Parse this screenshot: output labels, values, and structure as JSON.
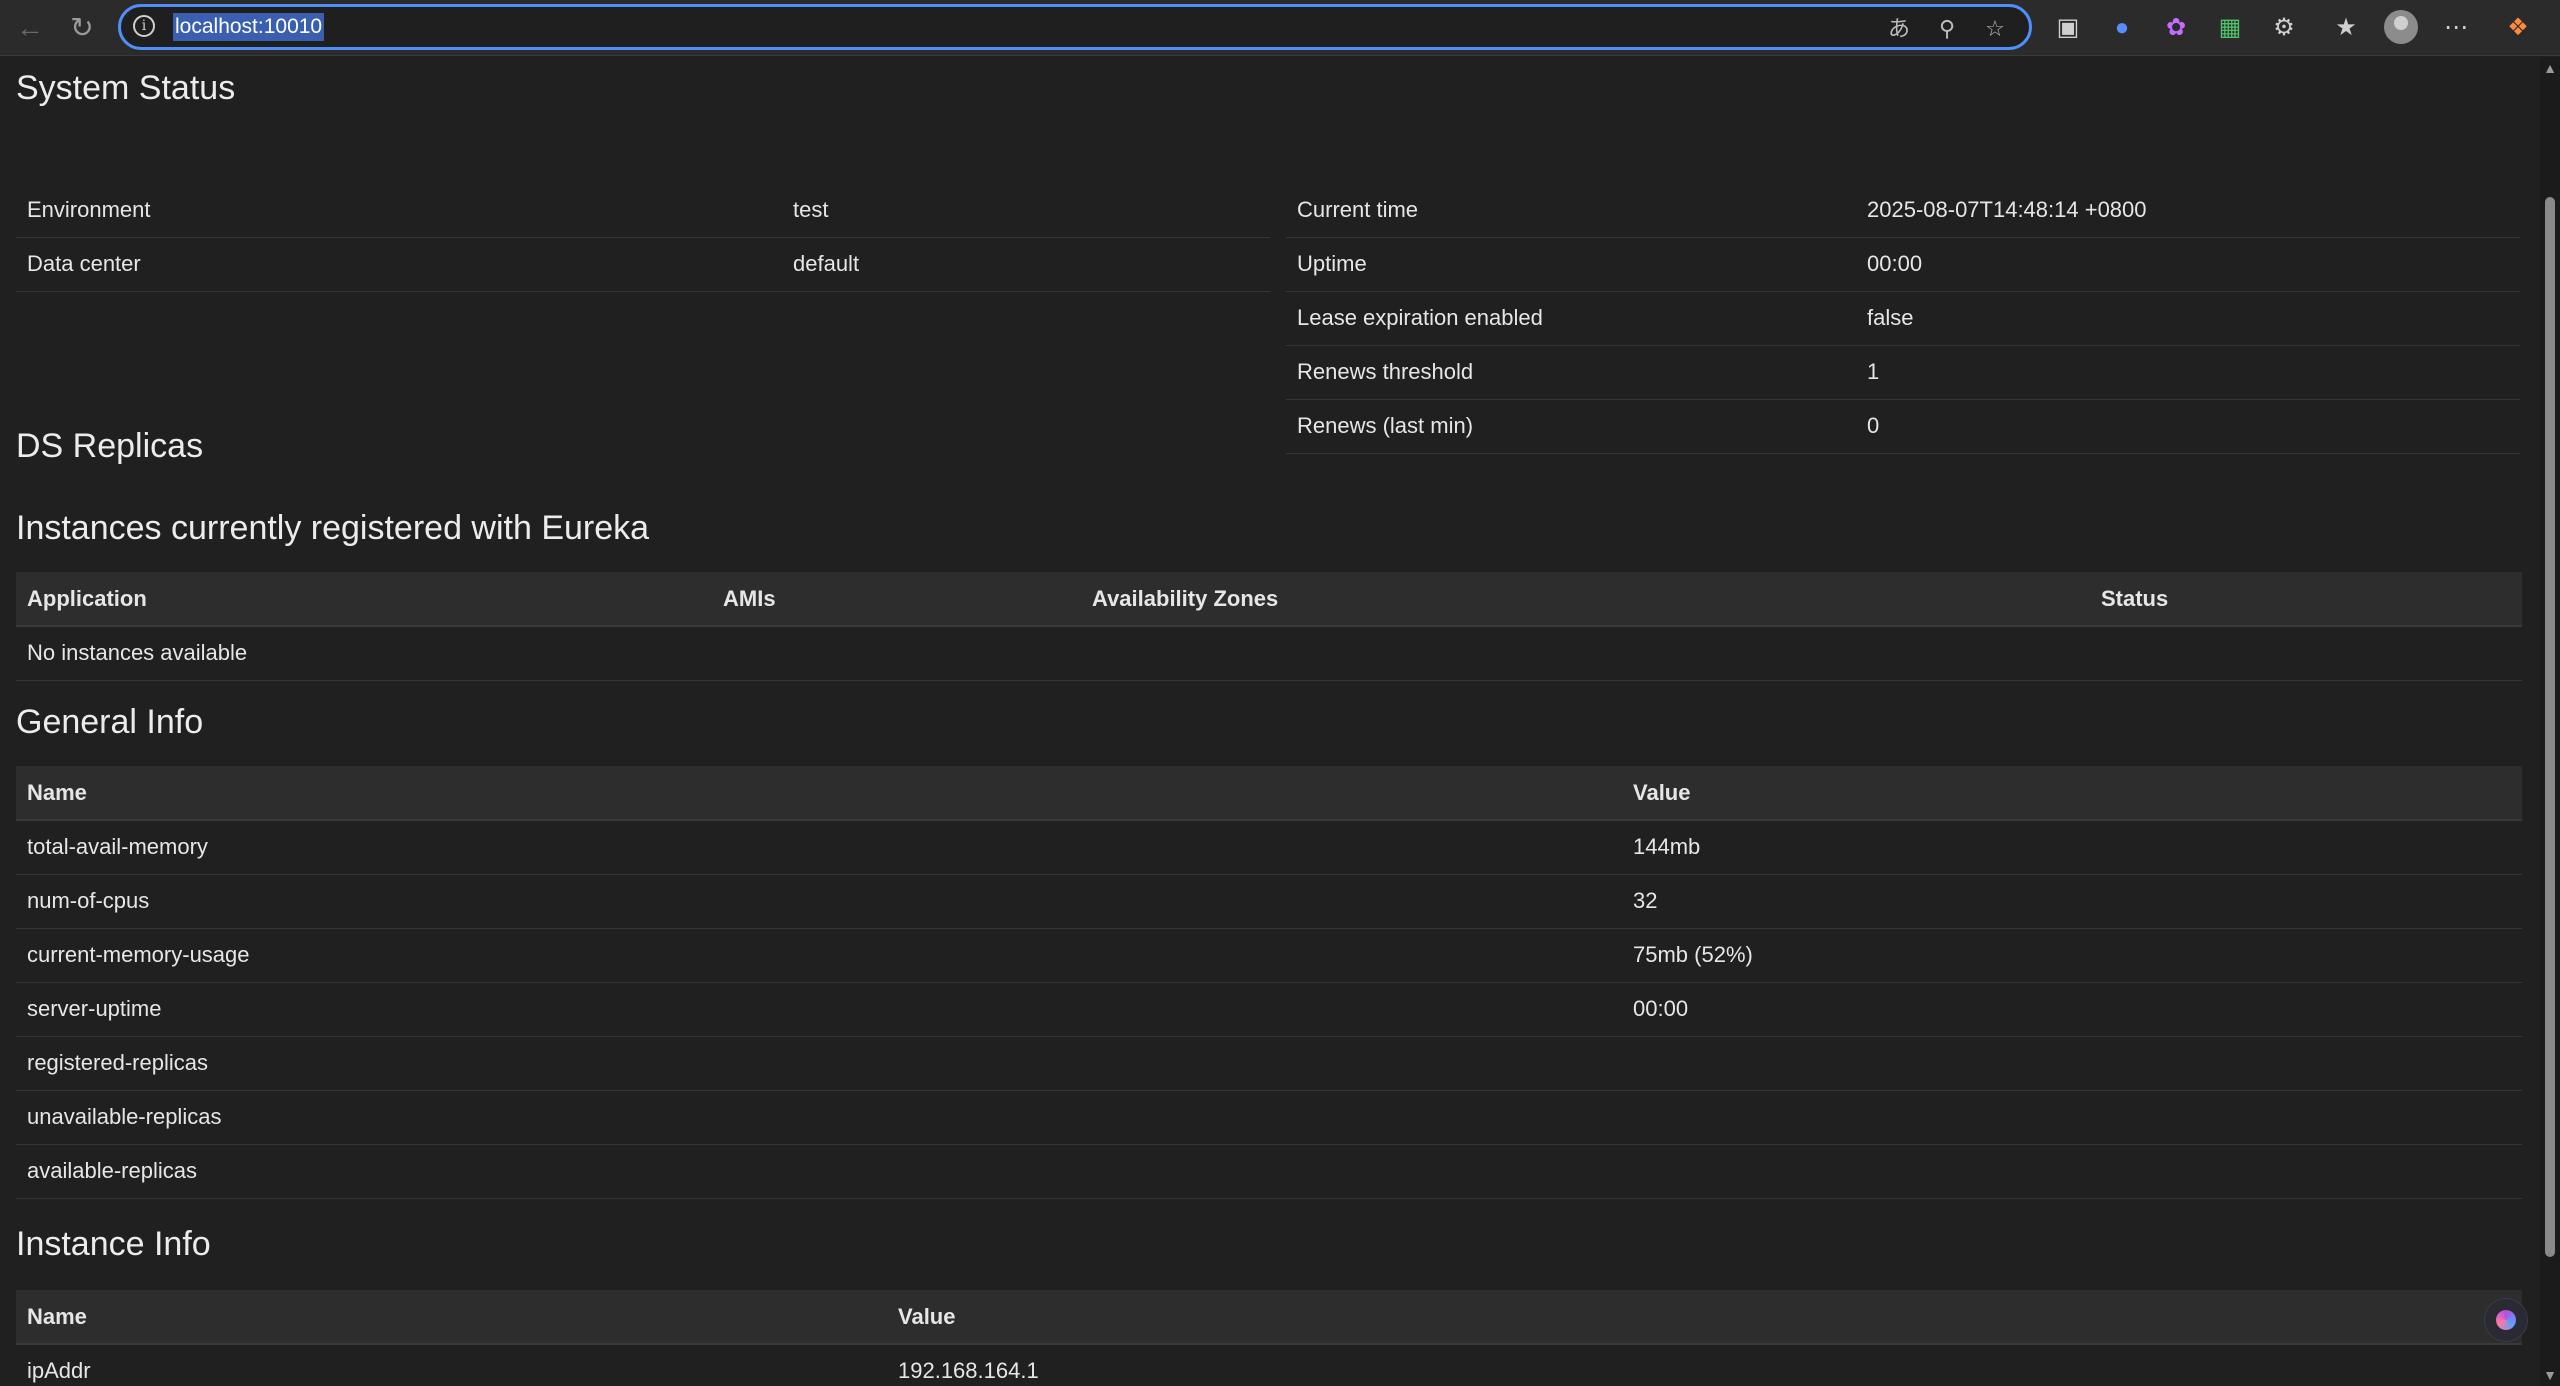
{
  "browser": {
    "url": "localhost:10010",
    "accent_color": "#4f8ff7",
    "icons": {
      "back": "back-arrow-icon",
      "reload": "reload-icon",
      "info": "site-info-icon",
      "read_aloud": "read-aloud-icon",
      "zoom": "zoom-icon",
      "favorite": "star-icon",
      "ext1": "extension-icon",
      "ext2": "extension-icon",
      "ext3": "extension-icon",
      "ext4": "extension-icon",
      "extensions": "puzzle-icon",
      "favorites": "favorites-icon",
      "profile": "profile-icon",
      "more": "more-icon",
      "copilot": "copilot-icon"
    }
  },
  "system_status": {
    "heading": "System Status",
    "left_rows": [
      {
        "label": "Environment",
        "value": "test"
      },
      {
        "label": "Data center",
        "value": "default"
      }
    ],
    "right_rows": [
      {
        "label": "Current time",
        "value": "2025-08-07T14:48:14 +0800"
      },
      {
        "label": "Uptime",
        "value": "00:00"
      },
      {
        "label": "Lease expiration enabled",
        "value": "false"
      },
      {
        "label": "Renews threshold",
        "value": "1"
      },
      {
        "label": "Renews (last min)",
        "value": "0"
      }
    ]
  },
  "ds_replicas": {
    "heading": "DS Replicas"
  },
  "instances": {
    "heading": "Instances currently registered with Eureka",
    "columns": [
      "Application",
      "AMIs",
      "Availability Zones",
      "Status"
    ],
    "empty_text": "No instances available"
  },
  "general_info": {
    "heading": "General Info",
    "columns": [
      "Name",
      "Value"
    ],
    "rows": [
      {
        "name": "total-avail-memory",
        "value": "144mb"
      },
      {
        "name": "num-of-cpus",
        "value": "32"
      },
      {
        "name": "current-memory-usage",
        "value": "75mb (52%)"
      },
      {
        "name": "server-uptime",
        "value": "00:00"
      },
      {
        "name": "registered-replicas",
        "value": ""
      },
      {
        "name": "unavailable-replicas",
        "value": ""
      },
      {
        "name": "available-replicas",
        "value": ""
      }
    ]
  },
  "instance_info": {
    "heading": "Instance Info",
    "columns": [
      "Name",
      "Value"
    ],
    "rows": [
      {
        "name": "ipAddr",
        "value": "192.168.164.1"
      }
    ]
  }
}
